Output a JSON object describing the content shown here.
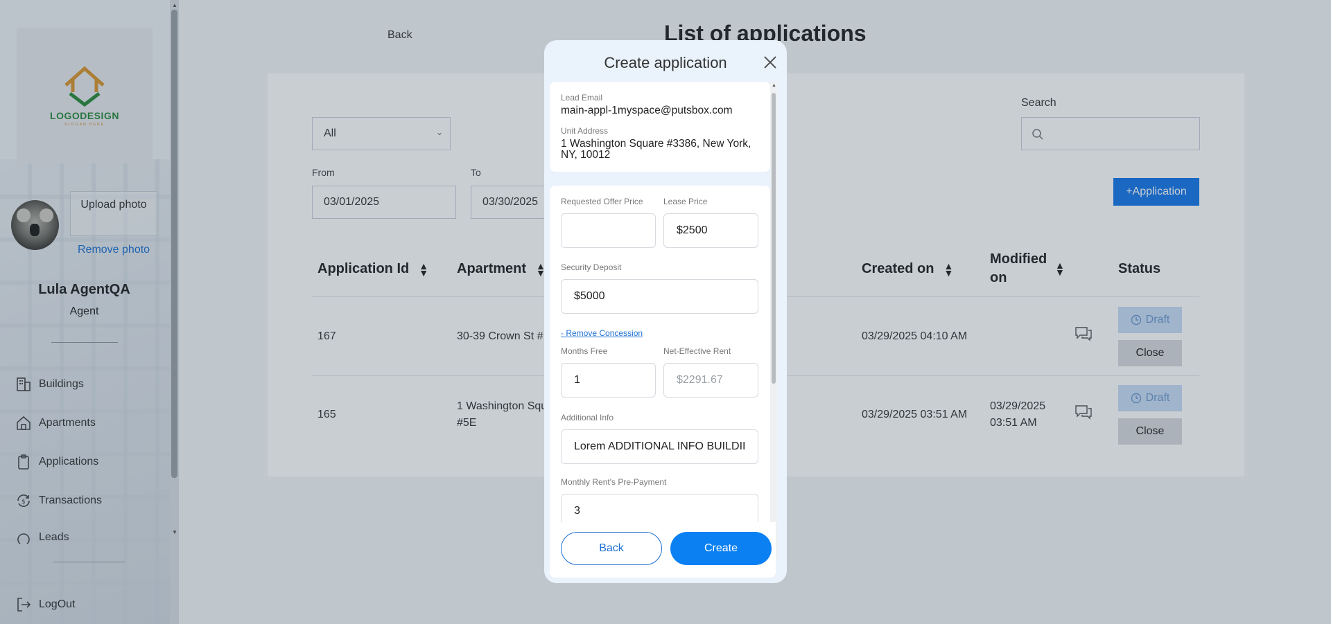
{
  "sidebar": {
    "logo_text": "LOGODESIGN",
    "logo_slogan": "SLOGAN HERE",
    "upload_photo": "Upload photo",
    "remove_photo": "Remove photo",
    "user_name": "Lula AgentQA",
    "user_role": "Agent",
    "nav": [
      {
        "label": "Buildings",
        "icon": "building-icon"
      },
      {
        "label": "Apartments",
        "icon": "house-icon"
      },
      {
        "label": "Applications",
        "icon": "clipboard-icon"
      },
      {
        "label": "Transactions",
        "icon": "transactions-icon"
      },
      {
        "label": "Leads",
        "icon": "leads-icon"
      }
    ],
    "logout": "LogOut"
  },
  "header": {
    "back": "Back",
    "title": "List of applications"
  },
  "filters": {
    "status_value": "All",
    "from_label": "From",
    "from_value": "03/01/2025",
    "to_label": "To",
    "to_value": "03/30/2025",
    "search_label": "Search",
    "add_button": "+Application"
  },
  "table": {
    "columns": [
      "Application Id",
      "Apartment",
      "Created on",
      "Modified on",
      "Status"
    ],
    "rows": [
      {
        "id": "167",
        "apartment": "30-39 Crown St #",
        "created": "03/29/2025 04:10 AM",
        "modified": "",
        "status": "Draft",
        "close": "Close"
      },
      {
        "id": "165",
        "apartment_line1": "1 Washington Squ",
        "apartment_line2": "#5E",
        "created": "03/29/2025 03:51 AM",
        "modified_line1": "03/29/2025",
        "modified_line2": "03:51 AM",
        "status": "Draft",
        "close": "Close"
      }
    ]
  },
  "modal": {
    "title": "Create application",
    "lead_email_label": "Lead Email",
    "lead_email": "main-appl-1myspace@putsbox.com",
    "unit_address_label": "Unit Address",
    "unit_address": "1 Washington Square #3386, New York, NY, 10012",
    "requested_offer_label": "Requested Offer Price",
    "requested_offer_value": "",
    "lease_price_label": "Lease Price",
    "lease_price_value": "$2500",
    "security_deposit_label": "Security Deposit",
    "security_deposit_value": "$5000",
    "remove_concession": "- Remove Concession",
    "months_free_label": "Months Free",
    "months_free_value": "1",
    "net_effective_label": "Net-Effective Rent",
    "net_effective_value": "$2291.67",
    "additional_info_label": "Additional Info",
    "additional_info_value": "Lorem ADDITIONAL INFO BUILDII",
    "prepayment_label": "Monthly Rent's Pre-Payment",
    "prepayment_value": "3",
    "back_button": "Back",
    "create_button": "Create"
  },
  "colors": {
    "accent": "#0b80f2",
    "draft_bg": "#c9ddf5",
    "link": "#1b6fd1"
  }
}
